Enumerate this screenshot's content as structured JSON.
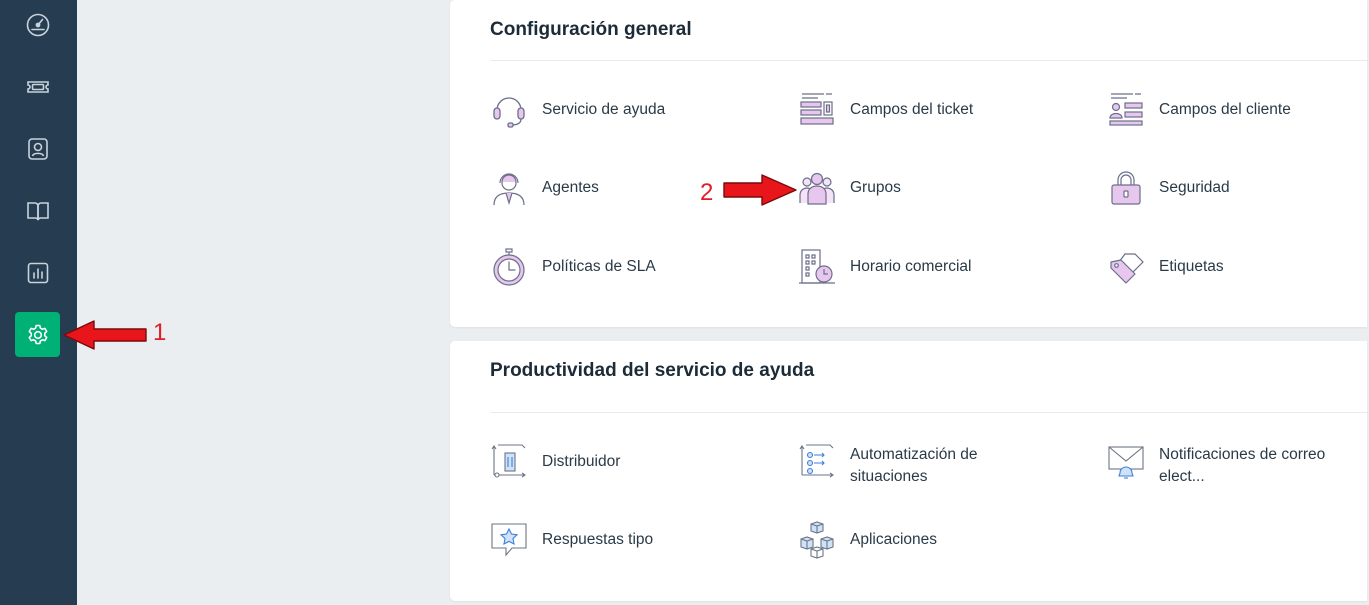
{
  "sidebar": {
    "items": [
      {
        "name": "dashboard",
        "icon": "gauge-icon"
      },
      {
        "name": "tickets",
        "icon": "ticket-icon"
      },
      {
        "name": "contacts",
        "icon": "contact-icon"
      },
      {
        "name": "solutions",
        "icon": "book-icon"
      },
      {
        "name": "reports",
        "icon": "bar-chart-icon"
      },
      {
        "name": "admin",
        "icon": "gear-icon",
        "active": true
      }
    ],
    "active_color": "#00b175",
    "background": "#263d51"
  },
  "general": {
    "title": "Configuración general",
    "items": [
      {
        "label": "Servicio de ayuda",
        "icon": "headset-icon"
      },
      {
        "label": "Campos del ticket",
        "icon": "ticket-fields-icon"
      },
      {
        "label": "Campos del cliente",
        "icon": "customer-fields-icon"
      },
      {
        "label": "Agentes",
        "icon": "agent-icon"
      },
      {
        "label": "Grupos",
        "icon": "group-icon"
      },
      {
        "label": "Seguridad",
        "icon": "lock-icon"
      },
      {
        "label": "Políticas de SLA",
        "icon": "stopwatch-icon"
      },
      {
        "label": "Horario comercial",
        "icon": "building-clock-icon"
      },
      {
        "label": "Etiquetas",
        "icon": "tag-icon"
      }
    ]
  },
  "productivity": {
    "title": "Productividad del servicio de ayuda",
    "items": [
      {
        "label": "Distribuidor",
        "icon": "dispatcher-icon"
      },
      {
        "label": "Automatización de situaciones",
        "icon": "automation-icon"
      },
      {
        "label": "Notificaciones de correo elect...",
        "icon": "email-notification-icon"
      },
      {
        "label": "Respuestas tipo",
        "icon": "canned-response-icon"
      },
      {
        "label": "Aplicaciones",
        "icon": "apps-icon"
      }
    ]
  },
  "annotations": {
    "first": "1",
    "second": "2",
    "color": "#e01e26"
  }
}
